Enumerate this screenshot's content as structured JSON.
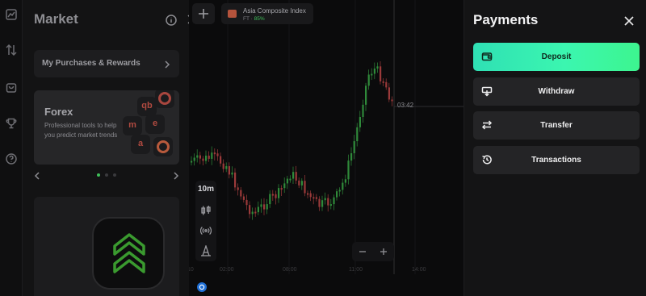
{
  "rail": {
    "icons": [
      "chart-icon",
      "swap-vertical-icon",
      "shopping-bag-icon",
      "trophy-icon",
      "help-icon"
    ]
  },
  "market": {
    "title": "Market",
    "purchases_label": "My Purchases & Rewards",
    "forex": {
      "title": "Forex",
      "description": "Professional tools to help you predict market trends"
    },
    "slides": {
      "count": 3,
      "active": 0
    }
  },
  "chart": {
    "asset_name": "Asia Composite Index",
    "asset_type": "FT",
    "asset_payout": "85%",
    "current_time_label": "03:42",
    "timeframe": "10m",
    "time_axis": [
      "10",
      "02:00",
      "08:00",
      "11:00",
      "14:00"
    ],
    "colors": {
      "up": "#2f8a3a",
      "down": "#9b3a3a",
      "accent": "#3fbf5a"
    }
  },
  "payments": {
    "title": "Payments",
    "buttons": [
      {
        "label": "Deposit",
        "icon": "wallet-icon"
      },
      {
        "label": "Withdraw",
        "icon": "withdraw-icon"
      },
      {
        "label": "Transfer",
        "icon": "transfer-icon"
      },
      {
        "label": "Transactions",
        "icon": "history-icon"
      }
    ],
    "deposit_gradient": [
      "#2fe0b4",
      "#3df58f"
    ]
  }
}
